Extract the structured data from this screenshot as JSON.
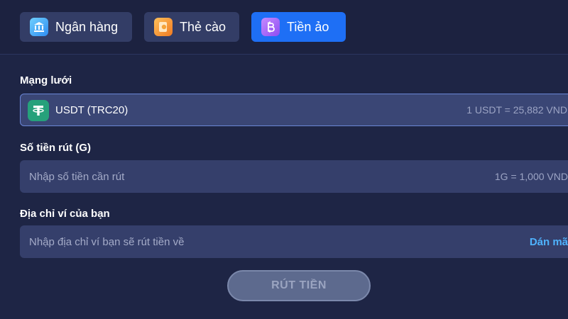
{
  "tabs": [
    {
      "label": "Ngân hàng",
      "icon": "bank-icon",
      "active": false
    },
    {
      "label": "Thẻ cào",
      "icon": "card-icon",
      "active": false
    },
    {
      "label": "Tiền ảo",
      "icon": "bitcoin-icon",
      "active": true
    }
  ],
  "network": {
    "label": "Mạng lưới",
    "selected": "USDT (TRC20)",
    "rate": "1 USDT = 25,882 VND",
    "icon": "tether-icon"
  },
  "amount": {
    "label": "Số tiền rút (G)",
    "placeholder": "Nhập số tiền cần rút",
    "rate": "1G = 1,000 VND"
  },
  "wallet": {
    "label": "Địa chỉ ví của bạn",
    "placeholder": "Nhập địa chỉ ví bạn sẽ rút tiền về",
    "paste_label": "Dán mã"
  },
  "submit_label": "RÚT TIỀN",
  "colors": {
    "background": "#1e2545",
    "active_tab": "#1e6ff5",
    "link": "#4fb3ff",
    "tether": "#26a17b"
  }
}
